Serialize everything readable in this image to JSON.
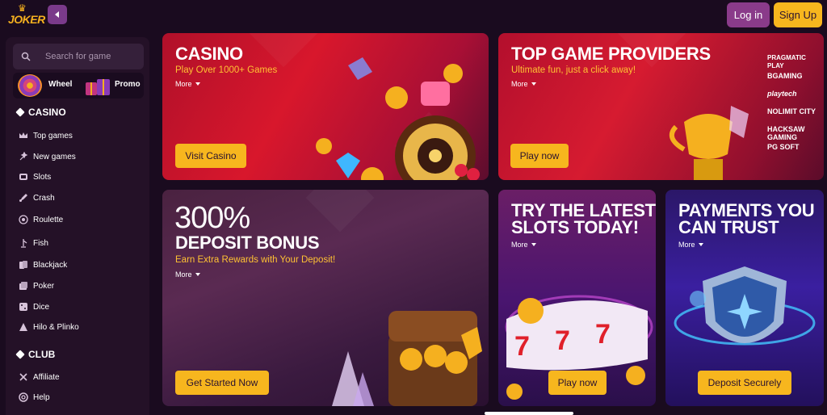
{
  "header": {
    "logo_text": "JOKER",
    "login": "Log in",
    "signup": "Sign Up"
  },
  "sidebar": {
    "search_placeholder": "Search for game",
    "quick": [
      {
        "label": "Wheel",
        "icon": "wheel-icon"
      },
      {
        "label": "Promo",
        "icon": "gift-icon"
      }
    ],
    "casino_title": "CASINO",
    "casino_items": [
      {
        "label": "Top games",
        "icon": "crown-icon"
      },
      {
        "label": "New games",
        "icon": "sparkle-icon"
      },
      {
        "label": "Slots",
        "icon": "slot-icon"
      },
      {
        "label": "Crash",
        "icon": "rocket-icon"
      },
      {
        "label": "Roulette",
        "icon": "roulette-icon"
      },
      {
        "label": "Fish",
        "icon": "fish-icon"
      },
      {
        "label": "Blackjack",
        "icon": "cards-icon"
      },
      {
        "label": "Poker",
        "icon": "poker-icon"
      },
      {
        "label": "Dice",
        "icon": "dice-icon"
      },
      {
        "label": "Hilo & Plinko",
        "icon": "pyramid-icon"
      }
    ],
    "club_title": "CLUB",
    "club_items": [
      {
        "label": "Affiliate",
        "icon": "affiliate-icon"
      },
      {
        "label": "Help",
        "icon": "help-icon"
      }
    ]
  },
  "cards": {
    "casino": {
      "title": "CASINO",
      "subtitle": "Play Over 1000+ Games",
      "more": "More",
      "button": "Visit Casino"
    },
    "providers": {
      "title": "TOP GAME PROVIDERS",
      "subtitle": "Ultimate fun, just a click away!",
      "more": "More",
      "button": "Play now",
      "logos": [
        "PRAGMATIC PLAY",
        "BGAMING",
        "playtech",
        "NOLIMIT CITY",
        "HACKSAW GAMING",
        "PG SOFT"
      ]
    },
    "bonus": {
      "big": "300%",
      "title": "DEPOSIT BONUS",
      "subtitle": "Earn Extra Rewards with Your Deposit!",
      "more": "More",
      "button": "Get Started Now"
    },
    "slots": {
      "title1": "TRY THE LATEST",
      "title2": "SLOTS TODAY!",
      "more": "More",
      "button": "Play now"
    },
    "payments": {
      "title1": "PAYMENTS YOU",
      "title2": "CAN TRUST",
      "more": "More",
      "button": "Deposit Securely"
    }
  },
  "colors": {
    "accent": "#f7b61e",
    "login_bg": "#8a3b8a",
    "background": "#1a0b1f"
  }
}
